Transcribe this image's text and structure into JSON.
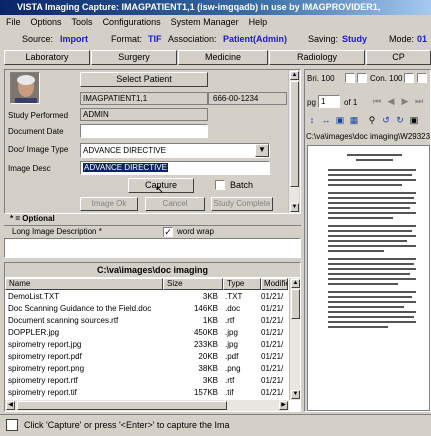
{
  "window": {
    "title": "VISTA  Imaging Capture:  IMAGPATIENT1,1    (isw-imgqadb)  in use by IMAGPROVIDER1,"
  },
  "menu": [
    "File",
    "Options",
    "Tools",
    "Configurations",
    "System Manager",
    "Help"
  ],
  "info": {
    "source_label": "Source:",
    "source_value": "Import",
    "format_label": "Format:",
    "format_value": "TIF",
    "association_label": "Association:",
    "association_value": "Patient(Admin)",
    "saving_label": "Saving:",
    "saving_value": "Study",
    "mode_label": "Mode:",
    "mode_value": "01"
  },
  "tabs": [
    "Laboratory",
    "Surgery",
    "Medicine",
    "Radiology",
    "CP"
  ],
  "patient": {
    "select_button": "Select Patient",
    "name": "IMAGPATIENT1,1",
    "ssn": "666-00-1234"
  },
  "form": {
    "study_performed_label": "Study Performed",
    "study_performed_value": "ADMIN",
    "document_date_label": "Document Date",
    "document_date_value": "",
    "doc_type_label": "Doc/ Image Type",
    "doc_type_value": "ADVANCE DIRECTIVE",
    "image_desc_label": "Image Desc",
    "image_desc_value": "ADVANCE DIRECTIVE",
    "capture_button": "Capture",
    "batch_label": "Batch",
    "image_ok_button": "Image Ok",
    "cancel_button": "Cancel",
    "study_complete_button": "Study Complete",
    "optional_label": "* = Optional",
    "long_desc_label": "Long Image Description *",
    "word_wrap_label": "word wrap"
  },
  "file_browser": {
    "path": "C:\\va\\images\\doc imaging",
    "columns": [
      "Name",
      "Size",
      "Type",
      "Modifie"
    ],
    "files": [
      {
        "name": "DemoList.TXT",
        "size": "3KB",
        "type": ".TXT",
        "modified": "01/21/"
      },
      {
        "name": "Doc Scanning Guidance to the Field.doc",
        "size": "146KB",
        "type": ".doc",
        "modified": "01/21/"
      },
      {
        "name": "Document scanning sources.rtf",
        "size": "1KB",
        "type": ".rtf",
        "modified": "01/21/"
      },
      {
        "name": "DOPPLER.jpg",
        "size": "450KB",
        "type": ".jpg",
        "modified": "01/21/"
      },
      {
        "name": "spirometry report.jpg",
        "size": "233KB",
        "type": ".jpg",
        "modified": "01/21/"
      },
      {
        "name": "spirometry report.pdf",
        "size": "20KB",
        "type": ".pdf",
        "modified": "01/21/"
      },
      {
        "name": "spirometry report.png",
        "size": "38KB",
        "type": ".png",
        "modified": "01/21/"
      },
      {
        "name": "spirometry report.rtf",
        "size": "3KB",
        "type": ".rtf",
        "modified": "01/21/"
      },
      {
        "name": "spirometry report.tif",
        "size": "157KB",
        "type": ".tif",
        "modified": "01/21/"
      }
    ]
  },
  "viewer": {
    "brightness_label": "Bri. 100",
    "contrast_label": "Con. 100",
    "page_label": "pg",
    "page_value": "1",
    "of_label": "of 1",
    "path": "C:\\va\\images\\doc imaging\\W29323"
  },
  "status": {
    "text": "Click 'Capture' or press '<Enter>' to capture the Ima"
  }
}
